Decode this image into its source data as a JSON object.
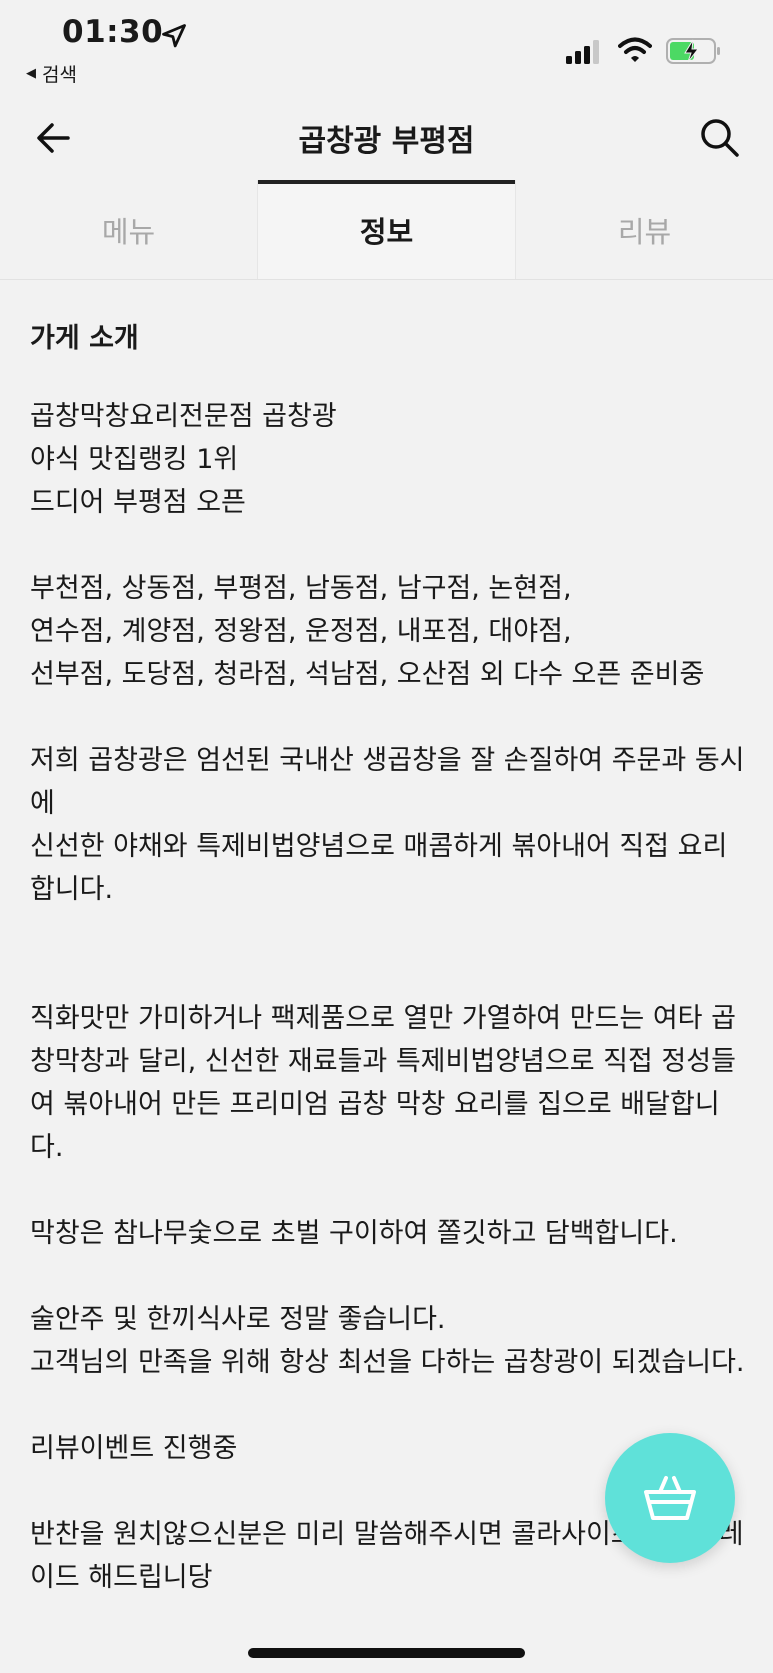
{
  "status_bar": {
    "time": "01:30",
    "back_app_label": "검색"
  },
  "nav": {
    "title": "곱창광 부평점"
  },
  "tabs": [
    {
      "label": "메뉴",
      "active": false
    },
    {
      "label": "정보",
      "active": true
    },
    {
      "label": "리뷰",
      "active": false
    }
  ],
  "content": {
    "heading": "가게 소개",
    "paragraphs": [
      "곱창막창요리전문점 곱창광\n야식 맛집랭킹 1위\n드디어 부평점 오픈",
      "부천점, 상동점, 부평점, 남동점, 남구점, 논현점,\n연수점, 계양점, 정왕점, 운정점, 내포점, 대야점,\n선부점, 도당점, 청라점, 석남점, 오산점 외 다수 오픈 준비중",
      "저희 곱창광은 엄선된 국내산 생곱창을 잘 손질하여 주문과 동시에\n신선한 야채와 특제비법양념으로 매콤하게 볶아내어 직접 요리합니다.",
      "직화맛만 가미하거나 팩제품으로 열만 가열하여 만드는 여타 곱창막창과 달리, 신선한 재료들과 특제비법양념으로 직접 정성들여 볶아내어 만든 프리미엄 곱창 막창 요리를 집으로 배달합니다.",
      "막창은 참나무숯으로 초벌 구이하여 쫄깃하고 담백합니다.",
      "술안주 및 한끼식사로 정말 좋습니다.\n고객님의 만족을 위해 항상 최선을 다하는 곱창광이 되겠습니다.",
      "리뷰이벤트 진행중",
      "반찬을 원치않으신분은 미리 말씀해주시면 콜라사이즈를 업그레이드 해드립니당"
    ]
  },
  "icons": {
    "location": "location-arrow-icon",
    "signal": "cellular-signal-icon",
    "wifi": "wifi-icon",
    "battery": "battery-charging-icon",
    "back": "back-arrow-icon",
    "search": "search-icon",
    "cart": "shopping-basket-icon"
  },
  "colors": {
    "fab": "#5fe1d9",
    "battery": "#4cd964"
  }
}
